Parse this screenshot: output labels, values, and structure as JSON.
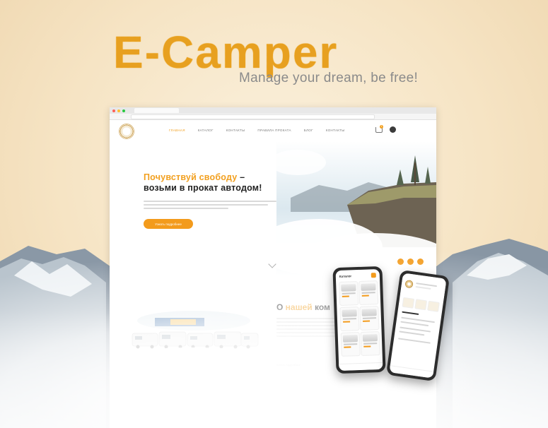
{
  "brand": {
    "title": "E-Camper",
    "tagline": "Manage your dream, be free!"
  },
  "colors": {
    "accent": "#f39b1c",
    "brand_yellow": "#f4b12d",
    "text_dark": "#222222"
  },
  "browser": {
    "nav": {
      "links": [
        "Главная",
        "Каталог",
        "Контакты",
        "Правила проката",
        "Блог",
        "Контакты"
      ],
      "active_index": 0,
      "cart_count": "1"
    },
    "hero": {
      "title_accent": "Почувствуй свободу",
      "title_rest": " –",
      "title_line2": "возьми в прокат автодом!",
      "button_label": "Узнать подробнее",
      "icons": [
        "facebook-icon",
        "instagram-icon",
        "vk-icon"
      ]
    },
    "about": {
      "title_prefix": "О ",
      "title_accent": "нашей",
      "title_rest": " ком",
      "link_label": "Узнать подробнее"
    }
  },
  "phones": {
    "catalog_title": "Каталог"
  }
}
